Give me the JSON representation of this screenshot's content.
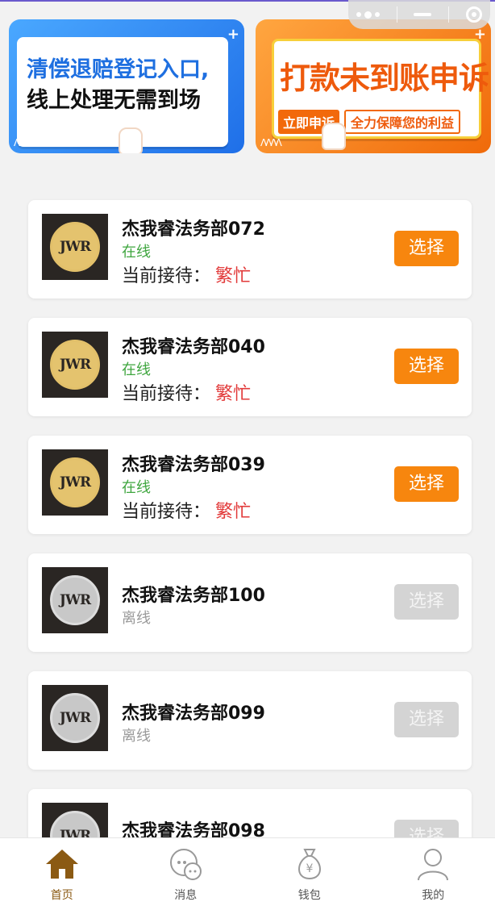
{
  "banners": [
    {
      "line1": "清偿退赔登记入口,",
      "line2": "线上处理无需到场"
    },
    {
      "line1": "打款未到账申诉",
      "tag_a": "立即申诉",
      "tag_b": "全力保障您的利益"
    }
  ],
  "logo_text": "JWR",
  "reception_label": "当前接待：",
  "select_label": "选择",
  "items": [
    {
      "name": "杰我睿法务部072",
      "status": "在线",
      "reception": "繁忙",
      "online": true
    },
    {
      "name": "杰我睿法务部040",
      "status": "在线",
      "reception": "繁忙",
      "online": true
    },
    {
      "name": "杰我睿法务部039",
      "status": "在线",
      "reception": "繁忙",
      "online": true
    },
    {
      "name": "杰我睿法务部100",
      "status": "离线",
      "online": false
    },
    {
      "name": "杰我睿法务部099",
      "status": "离线",
      "online": false
    },
    {
      "name": "杰我睿法务部098",
      "status": "",
      "online": false
    }
  ],
  "tabs": [
    {
      "label": "首页",
      "icon": "home-icon",
      "active": true
    },
    {
      "label": "消息",
      "icon": "message-icon",
      "active": false
    },
    {
      "label": "钱包",
      "icon": "wallet-icon",
      "active": false
    },
    {
      "label": "我的",
      "icon": "profile-icon",
      "active": false
    }
  ],
  "colors": {
    "accent": "#f7860e",
    "online": "#3fa63f",
    "busy": "#e23a3a",
    "tab_active": "#8b5a13"
  }
}
